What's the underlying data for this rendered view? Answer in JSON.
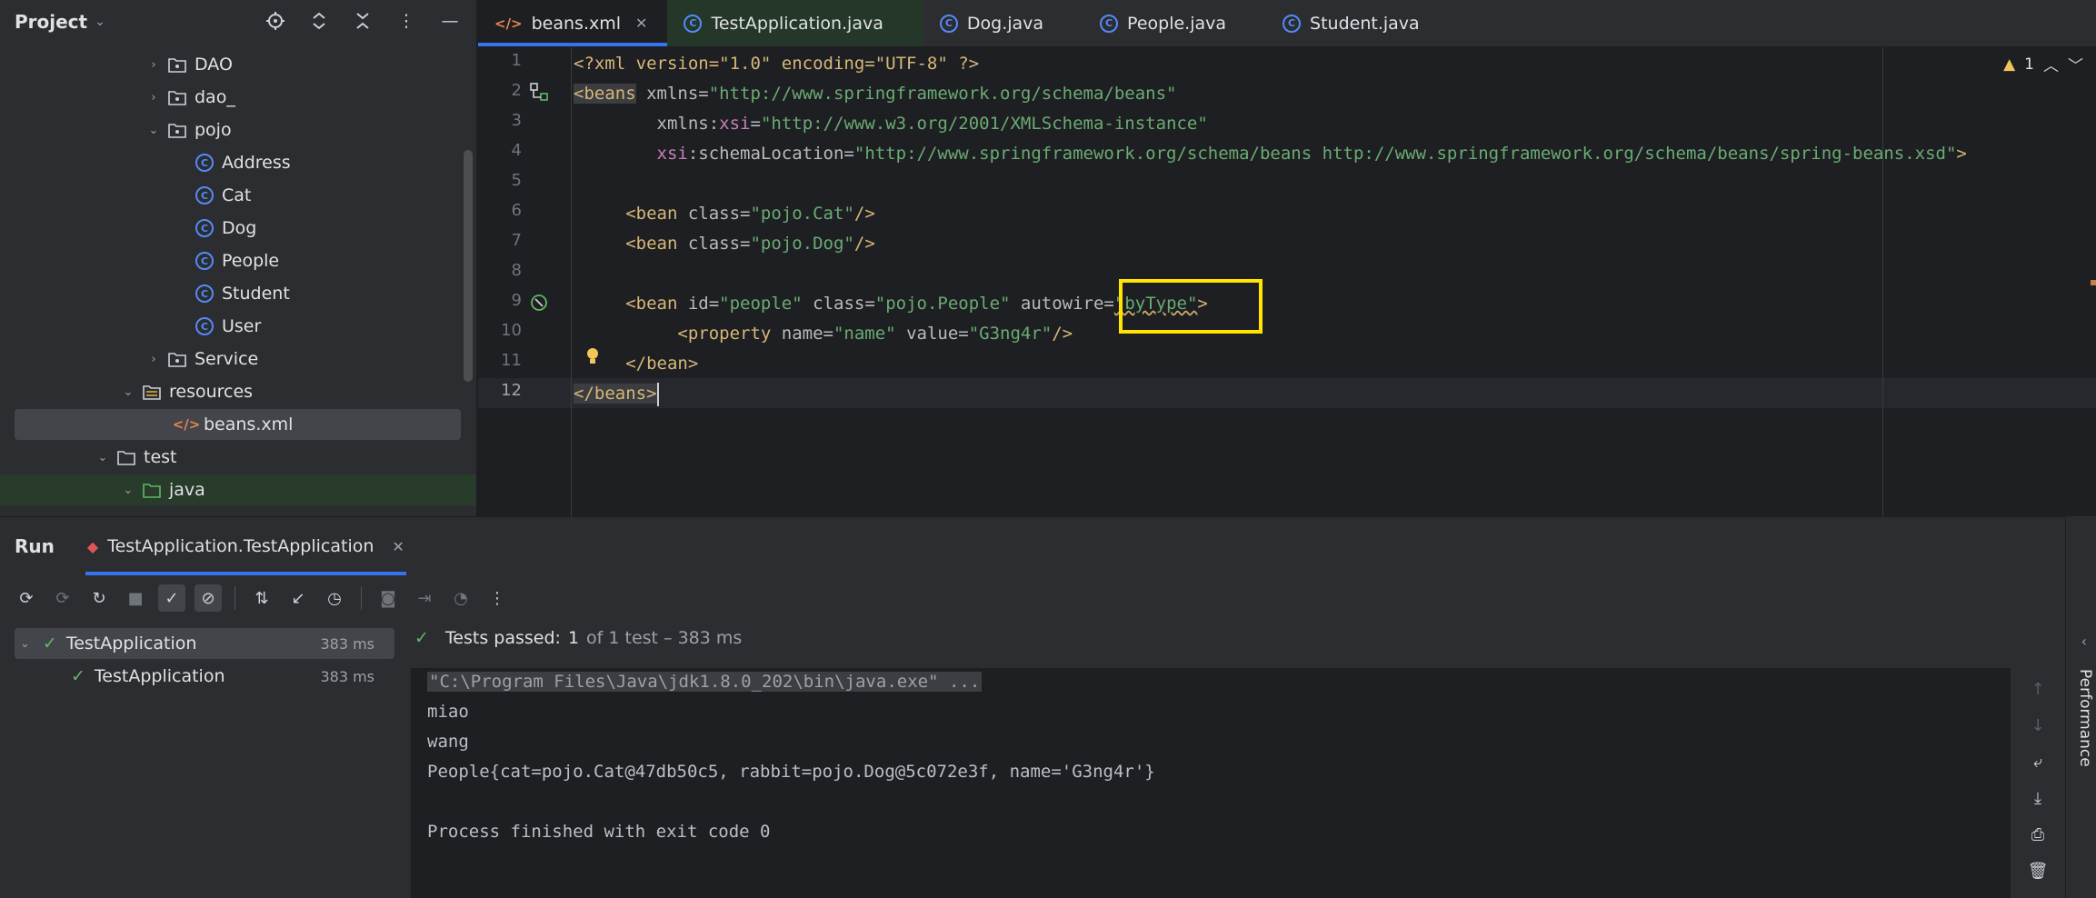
{
  "project": {
    "title": "Project",
    "tree": [
      {
        "label": "DAO",
        "kind": "package",
        "expanded": false
      },
      {
        "label": "dao_",
        "kind": "package",
        "expanded": false
      },
      {
        "label": "pojo",
        "kind": "package",
        "expanded": true
      },
      {
        "label": "Address",
        "kind": "class"
      },
      {
        "label": "Cat",
        "kind": "class"
      },
      {
        "label": "Dog",
        "kind": "class"
      },
      {
        "label": "People",
        "kind": "class"
      },
      {
        "label": "Student",
        "kind": "class"
      },
      {
        "label": "User",
        "kind": "class"
      },
      {
        "label": "Service",
        "kind": "package",
        "expanded": false
      },
      {
        "label": "resources",
        "kind": "resources-folder",
        "expanded": true
      },
      {
        "label": "beans.xml",
        "kind": "xml-file",
        "selected": true
      },
      {
        "label": "test",
        "kind": "folder",
        "expanded": true
      },
      {
        "label": "java",
        "kind": "test-folder",
        "expanded": true
      }
    ]
  },
  "editor": {
    "tabs": [
      {
        "label": "beans.xml",
        "icon": "xml-icon",
        "active": true,
        "closable": true
      },
      {
        "label": "TestApplication.java",
        "icon": "class-icon",
        "active": false
      },
      {
        "label": "Dog.java",
        "icon": "class-icon",
        "active": false
      },
      {
        "label": "People.java",
        "icon": "class-icon",
        "active": false
      },
      {
        "label": "Student.java",
        "icon": "class-icon",
        "active": false
      }
    ],
    "line_numbers": [
      "1",
      "2",
      "3",
      "4",
      "5",
      "6",
      "7",
      "8",
      "9",
      "10",
      "11",
      "12"
    ],
    "lines": {
      "l1_pi": "<?xml version=\"1.0\" encoding=\"UTF-8\" ?>",
      "l2_tag": "<beans",
      "l2_attr": " xmlns=",
      "l2_val": "\"http://www.springframework.org/schema/beans\"",
      "l3_attr": "xmlns:",
      "l3_ns": "xsi",
      "l3_eq": "=",
      "l3_val": "\"http://www.w3.org/2001/XMLSchema-instance\"",
      "l4_ns": "xsi",
      "l4_attr": ":schemaLocation=",
      "l4_val": "\"http://www.springframework.org/schema/beans http://www.springframework.org/schema/beans/spring-beans.xsd\"",
      "l4_end": ">",
      "l6_tag": "<bean",
      "l6_attr": " class=",
      "l6_val": "\"pojo.Cat\"",
      "l6_end": "/>",
      "l7_tag": "<bean",
      "l7_attr": " class=",
      "l7_val": "\"pojo.Dog\"",
      "l7_end": "/>",
      "l9_tag": "<bean",
      "l9_attr1": " id=",
      "l9_val1": "\"people\"",
      "l9_attr2": " class=",
      "l9_val2": "\"pojo.People\"",
      "l9_attr3": " autowire=",
      "l9_val3": "\"byType\"",
      "l9_end": ">",
      "l10_tag": "<property",
      "l10_attr1": " name=",
      "l10_val1": "\"name\"",
      "l10_attr2": " value=",
      "l10_val2": "\"G3ng4r\"",
      "l10_end": "/>",
      "l11_tag": "</bean>",
      "l12_tag": "</beans>"
    },
    "inspection": {
      "warnings": "1"
    }
  },
  "run": {
    "title": "Run",
    "tab_label": "TestApplication.TestApplication",
    "tests": [
      {
        "label": "TestApplication",
        "duration": "383 ms",
        "level": 0
      },
      {
        "label": "TestApplication",
        "duration": "383 ms",
        "level": 1
      }
    ],
    "status_prefix": "Tests passed:",
    "status_count": "1",
    "status_meta": "of 1 test – 383 ms",
    "console": {
      "command": "\"C:\\Program Files\\Java\\jdk1.8.0_202\\bin\\java.exe\" ...",
      "out1": "miao",
      "out2": "wang",
      "out3": "People{cat=pojo.Cat@47db50c5, rabbit=pojo.Dog@5c072e3f, name='G3ng4r'}",
      "out4": "Process finished with exit code 0"
    }
  },
  "side_panel": {
    "label": "Performance"
  },
  "colors": {
    "accent": "#3574f0",
    "highlight_box": "#ffe500",
    "success": "#5fb865"
  }
}
